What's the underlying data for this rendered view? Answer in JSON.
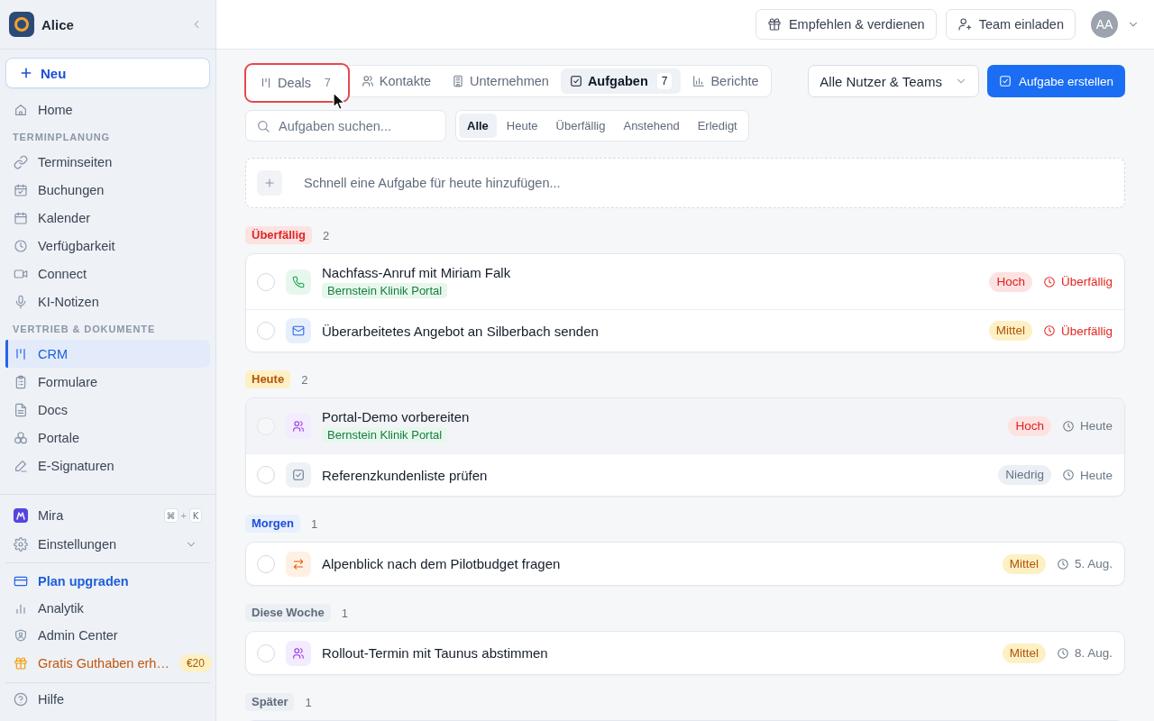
{
  "sidebar": {
    "workspace": "Alice",
    "new_button": "Neu",
    "nav": [
      {
        "kind": "item",
        "label": "Home",
        "selected": false
      },
      {
        "kind": "heading",
        "label": "TERMINPLANUNG"
      },
      {
        "kind": "item",
        "label": "Terminseiten",
        "selected": false
      },
      {
        "kind": "item",
        "label": "Buchungen",
        "selected": false
      },
      {
        "kind": "item",
        "label": "Kalender",
        "selected": false
      },
      {
        "kind": "item",
        "label": "Verfügbarkeit",
        "selected": false
      },
      {
        "kind": "item",
        "label": "Connect",
        "selected": false
      },
      {
        "kind": "item",
        "label": "KI-Notizen",
        "selected": false
      },
      {
        "kind": "heading",
        "label": "VERTRIEB & DOKUMENTE"
      },
      {
        "kind": "item",
        "label": "CRM",
        "selected": true
      },
      {
        "kind": "item",
        "label": "Formulare",
        "selected": false
      },
      {
        "kind": "item",
        "label": "Docs",
        "selected": false
      },
      {
        "kind": "item",
        "label": "Portale",
        "selected": false
      },
      {
        "kind": "item",
        "label": "E-Signaturen",
        "selected": false
      }
    ],
    "assistant": {
      "label": "Mira",
      "shortcut": {
        "keys": [
          "⌘",
          "K"
        ],
        "joiner": "+"
      }
    },
    "settings": {
      "label": "Einstellungen",
      "expanded": false
    },
    "links": [
      {
        "label": "Plan upgraden",
        "kind": "upgrade"
      },
      {
        "label": "Analytik",
        "kind": "plain"
      },
      {
        "label": "Admin Center",
        "kind": "plain"
      },
      {
        "label": "Gratis Guthaben erh…",
        "kind": "promo",
        "badge": "€20"
      }
    ],
    "help": "Hilfe"
  },
  "header": {
    "buttons": [
      "Empfehlen & verdienen",
      "Team einladen"
    ],
    "avatar": "AA"
  },
  "tabs": [
    {
      "label": "Deals",
      "count": "7",
      "selected": false,
      "highlighted": true
    },
    {
      "label": "Kontakte",
      "selected": false,
      "highlighted": false
    },
    {
      "label": "Unternehmen",
      "selected": false,
      "highlighted": false
    },
    {
      "label": "Aufgaben",
      "count": "7",
      "selected": true,
      "highlighted": false
    },
    {
      "label": "Berichte",
      "selected": false,
      "highlighted": false
    }
  ],
  "owner_filter": {
    "value": "Alle Nutzer & Teams"
  },
  "create_button": "Aufgabe erstellen",
  "search": {
    "placeholder": "Aufgaben suchen..."
  },
  "filters": [
    {
      "label": "Alle",
      "selected": true
    },
    {
      "label": "Heute",
      "selected": false
    },
    {
      "label": "Überfällig",
      "selected": false
    },
    {
      "label": "Anstehend",
      "selected": false
    },
    {
      "label": "Erledigt",
      "selected": false
    }
  ],
  "quick_add": {
    "placeholder": "Schnell eine Aufgabe für heute hinzufügen..."
  },
  "groups": [
    {
      "label": "Überfällig",
      "kind": "overdue",
      "count": "2",
      "tasks": [
        {
          "kind": "call",
          "title": "Nachfass-Anruf mit Miriam Falk",
          "tag": "Bernstein Klinik Portal",
          "priority": {
            "label": "Hoch",
            "kind": "high"
          },
          "due": "Überfällig",
          "overdue": true,
          "checked": false,
          "hovered": false
        },
        {
          "kind": "email",
          "title": "Überarbeitetes Angebot an Silberbach senden",
          "priority": {
            "label": "Mittel",
            "kind": "medium"
          },
          "due": "Überfällig",
          "overdue": true,
          "checked": false,
          "hovered": false
        }
      ]
    },
    {
      "label": "Heute",
      "kind": "today",
      "count": "2",
      "tasks": [
        {
          "kind": "meeting",
          "title": "Portal-Demo vorbereiten",
          "tag": "Bernstein Klinik Portal",
          "priority": {
            "label": "Hoch",
            "kind": "high"
          },
          "due": "Heute",
          "overdue": false,
          "checked": false,
          "hovered": true
        },
        {
          "kind": "task",
          "title": "Referenzkundenliste prüfen",
          "priority": {
            "label": "Niedrig",
            "kind": "low"
          },
          "due": "Heute",
          "overdue": false,
          "checked": false,
          "hovered": false
        }
      ]
    },
    {
      "label": "Morgen",
      "kind": "tomorrow",
      "count": "1",
      "tasks": [
        {
          "kind": "followup",
          "title": "Alpenblick nach dem Pilotbudget fragen",
          "priority": {
            "label": "Mittel",
            "kind": "medium"
          },
          "due": "5. Aug.",
          "overdue": false,
          "checked": false,
          "hovered": false
        }
      ]
    },
    {
      "label": "Diese Woche",
      "kind": "week",
      "count": "1",
      "tasks": [
        {
          "kind": "meeting",
          "title": "Rollout-Termin mit Taunus abstimmen",
          "priority": {
            "label": "Mittel",
            "kind": "medium"
          },
          "due": "8. Aug.",
          "overdue": false,
          "checked": false,
          "hovered": false
        }
      ]
    },
    {
      "label": "Später",
      "kind": "later",
      "count": "1"
    }
  ]
}
